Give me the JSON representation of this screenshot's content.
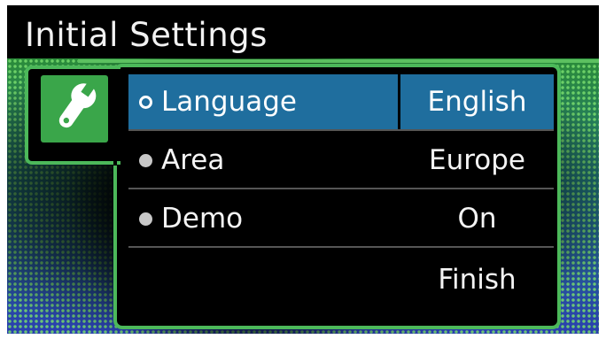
{
  "header": {
    "title": "Initial Settings"
  },
  "icon": {
    "name": "wrench-icon"
  },
  "settings": [
    {
      "label": "Language",
      "value": "English",
      "selected": true
    },
    {
      "label": "Area",
      "value": "Europe",
      "selected": false
    },
    {
      "label": "Demo",
      "value": "On",
      "selected": false
    }
  ],
  "actions": {
    "finish_label": "Finish"
  },
  "colors": {
    "accent_green": "#4cb85a",
    "selected_row": "#1f6e9e",
    "text": "#f4f4f4"
  }
}
